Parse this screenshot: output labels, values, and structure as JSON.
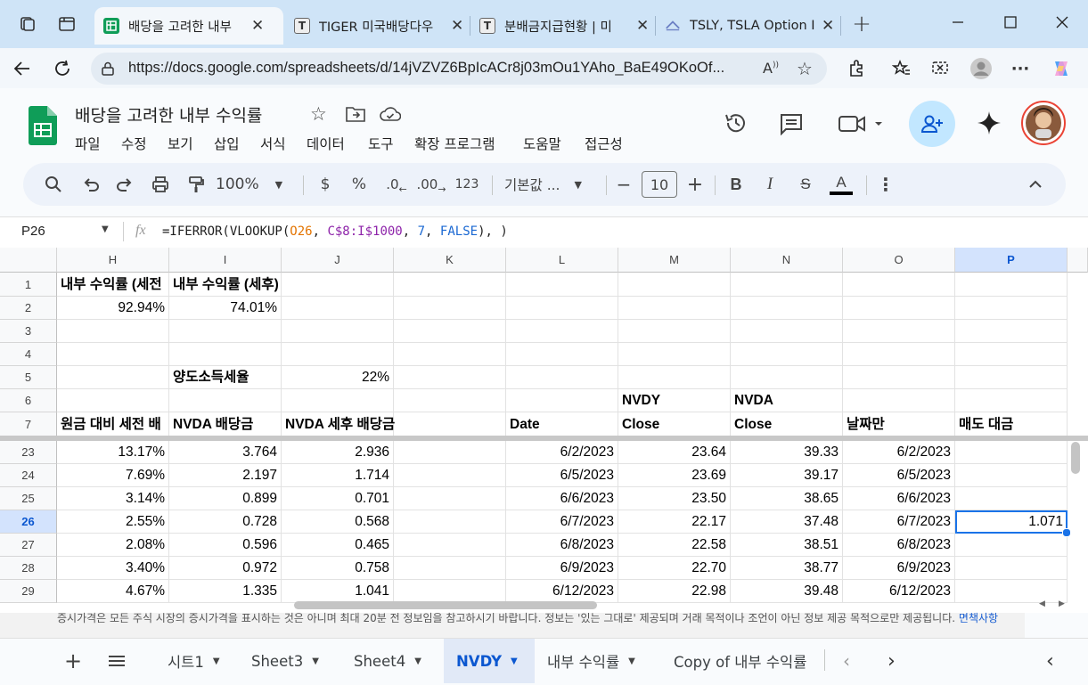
{
  "browser": {
    "tabs": [
      {
        "label": "배당을 고려한 내부",
        "icon": "sheets-icon",
        "active": true
      },
      {
        "label": "TIGER 미국배당다우",
        "icon": "document-icon",
        "active": false
      },
      {
        "label": "분배금지급현황 | 미",
        "icon": "document-icon",
        "active": false
      },
      {
        "label": "TSLY, TSLA Option In",
        "icon": "site-icon",
        "active": false
      }
    ],
    "url": "https://docs.google.com/spreadsheets/d/14jVZVZ6BpIcACr8j03mOu1YAho_BaE49OKoOf..."
  },
  "sheets": {
    "title": "배당을 고려한 내부 수익률",
    "menu": [
      "파일",
      "수정",
      "보기",
      "삽입",
      "서식",
      "데이터",
      "도구",
      "확장 프로그램",
      "도움말",
      "접근성"
    ],
    "toolbar": {
      "zoom": "100%",
      "currency": "$",
      "percent": "%",
      "dec_decrease": ".0",
      "dec_increase": ".00",
      "number_format": "123",
      "font": "기본값 ...",
      "font_size": "10",
      "minus": "−",
      "plus": "+"
    },
    "formula_bar": {
      "cell_ref": "P26",
      "fx": "fx",
      "formula_prefix": "=IFERROR(VLOOKUP(",
      "formula_ref1": "O26",
      "formula_comma1": ", ",
      "formula_ref2": "C$8:I$1000",
      "formula_comma2": ", ",
      "formula_num": "7",
      "formula_comma3": ", ",
      "formula_false": "FALSE",
      "formula_suffix": "), )"
    },
    "columns": [
      "H",
      "I",
      "J",
      "K",
      "L",
      "M",
      "N",
      "O",
      "P"
    ],
    "rows": [
      {
        "num": "1",
        "cells": {
          "H": "내부 수익률 (세전",
          "I": "내부 수익률 (세후)"
        }
      },
      {
        "num": "2",
        "cells": {
          "H": "92.94%",
          "I": "74.01%"
        }
      },
      {
        "num": "3",
        "cells": {}
      },
      {
        "num": "4",
        "cells": {}
      },
      {
        "num": "5",
        "cells": {
          "I": "양도소득세율",
          "J": "22%"
        }
      },
      {
        "num": "6",
        "cells": {
          "M": "NVDY",
          "N": "NVDA"
        }
      },
      {
        "num": "7",
        "cells": {
          "H": "원금 대비 세전 배",
          "I": "NVDA 배당금",
          "J": "NVDA 세후 배당금",
          "L": "Date",
          "M": "Close",
          "N": "Close",
          "O": "날짜만",
          "P": "매도 대금"
        }
      },
      {
        "num": "23",
        "cells": {
          "H": "13.17%",
          "I": "3.764",
          "J": "2.936",
          "L": "6/2/2023",
          "M": "23.64",
          "N": "39.33",
          "O": "6/2/2023"
        }
      },
      {
        "num": "24",
        "cells": {
          "H": "7.69%",
          "I": "2.197",
          "J": "1.714",
          "L": "6/5/2023",
          "M": "23.69",
          "N": "39.17",
          "O": "6/5/2023"
        }
      },
      {
        "num": "25",
        "cells": {
          "H": "3.14%",
          "I": "0.899",
          "J": "0.701",
          "L": "6/6/2023",
          "M": "23.50",
          "N": "38.65",
          "O": "6/6/2023"
        }
      },
      {
        "num": "26",
        "cells": {
          "H": "2.55%",
          "I": "0.728",
          "J": "0.568",
          "L": "6/7/2023",
          "M": "22.17",
          "N": "37.48",
          "O": "6/7/2023",
          "P": "1.071"
        }
      },
      {
        "num": "27",
        "cells": {
          "H": "2.08%",
          "I": "0.596",
          "J": "0.465",
          "L": "6/8/2023",
          "M": "22.58",
          "N": "38.51",
          "O": "6/8/2023"
        }
      },
      {
        "num": "28",
        "cells": {
          "H": "3.40%",
          "I": "0.972",
          "J": "0.758",
          "L": "6/9/2023",
          "M": "22.70",
          "N": "38.77",
          "O": "6/9/2023"
        }
      },
      {
        "num": "29",
        "cells": {
          "H": "4.67%",
          "I": "1.335",
          "J": "1.041",
          "L": "6/12/2023",
          "M": "22.98",
          "N": "39.48",
          "O": "6/12/2023"
        }
      }
    ],
    "selected_cell": "P26",
    "notice": "증시가격은 모든 주식 시장의 증시가격을 표시하는 것은 아니며 최대 20분 전 정보임을 참고하시기 바랍니다. 정보는 '있는 그대로' 제공되며 거래 목적이나 조언이 아닌 정보 제공 목적으로만 제공됩니다.",
    "notice_link": "면책사항",
    "sheet_tabs": [
      "시트1",
      "Sheet3",
      "Sheet4",
      "NVDY",
      "내부 수익률",
      "Copy of 내부 수익률"
    ],
    "active_sheet": "NVDY"
  },
  "colors": {
    "accent": "#0b57d0",
    "sheets_green": "#0f9d58",
    "active_tab_bg": "#e1e9f7"
  }
}
